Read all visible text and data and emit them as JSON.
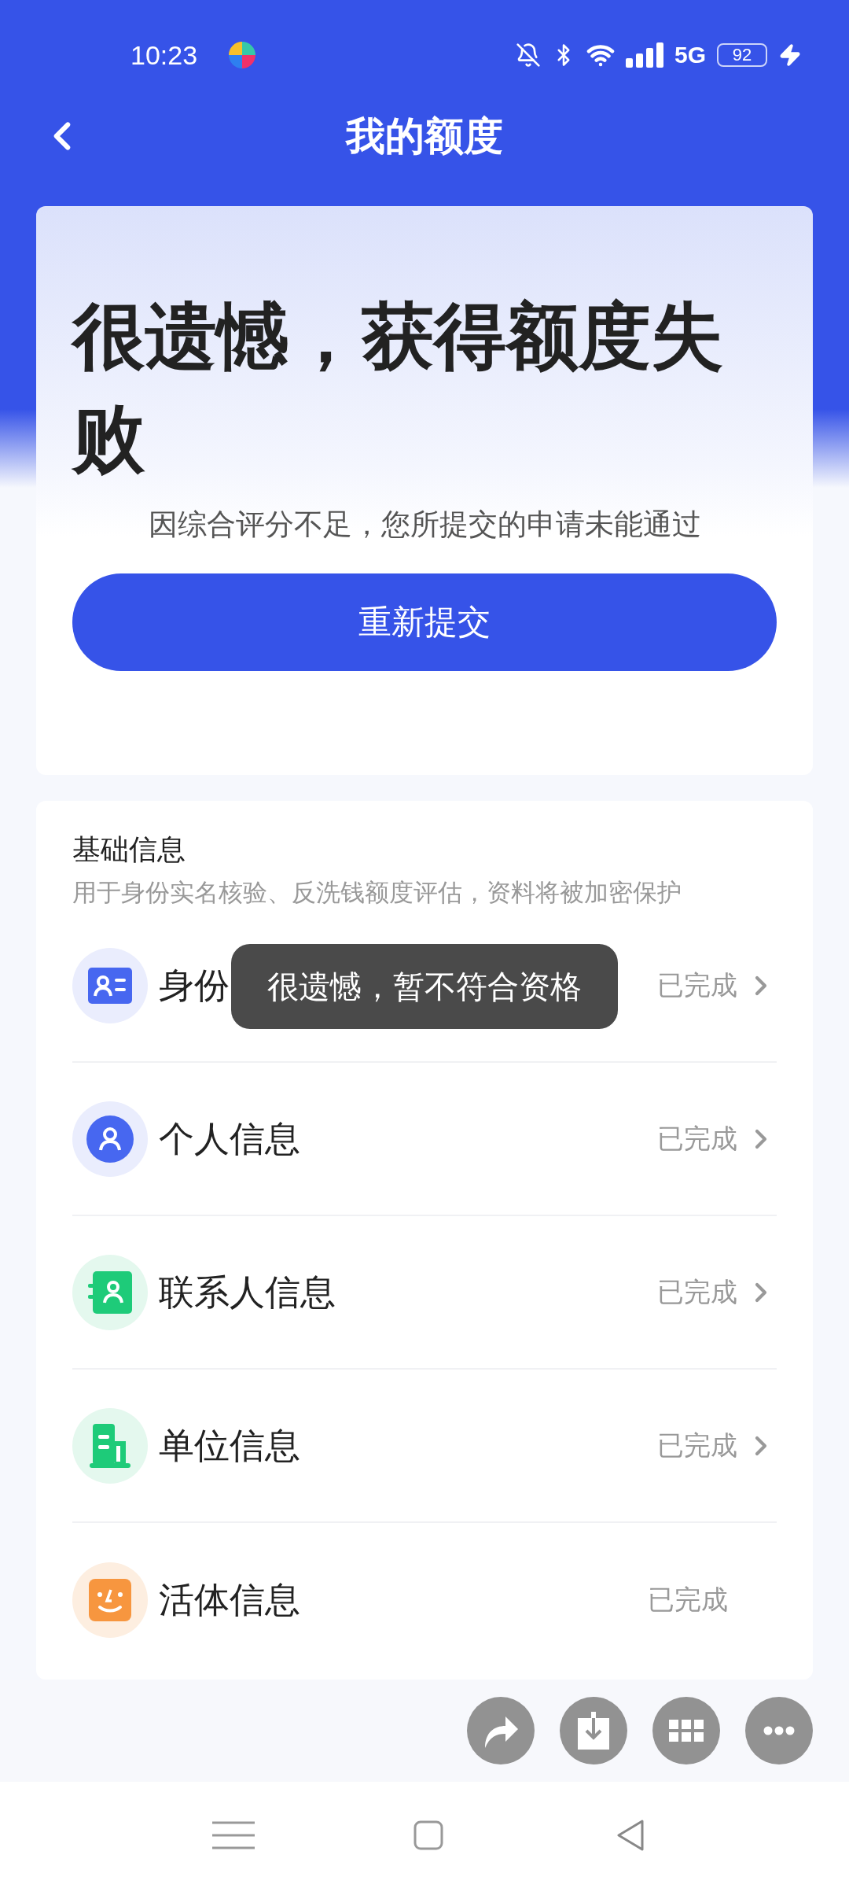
{
  "status_bar": {
    "time": "10:23",
    "network": "5G",
    "battery": "92"
  },
  "header": {
    "title": "我的额度"
  },
  "result": {
    "headline": "很遗憾，获得额度失败",
    "message": "因综合评分不足，您所提交的申请未能通过",
    "button": "重新提交"
  },
  "basic_info": {
    "title": "基础信息",
    "subtitle": "用于身份实名核验、反洗钱额度评估，资料将被加密保护",
    "rows": [
      {
        "kind": "id-card",
        "label": "身份",
        "status": "已完成",
        "arrow": true
      },
      {
        "kind": "person",
        "label": "个人信息",
        "status": "已完成",
        "arrow": true
      },
      {
        "kind": "contacts",
        "label": "联系人信息",
        "status": "已完成",
        "arrow": true
      },
      {
        "kind": "building",
        "label": "单位信息",
        "status": "已完成",
        "arrow": true
      },
      {
        "kind": "face",
        "label": "活体信息",
        "status": "已完成",
        "arrow": false
      }
    ]
  },
  "toast": "很遗憾，暂不符合资格"
}
